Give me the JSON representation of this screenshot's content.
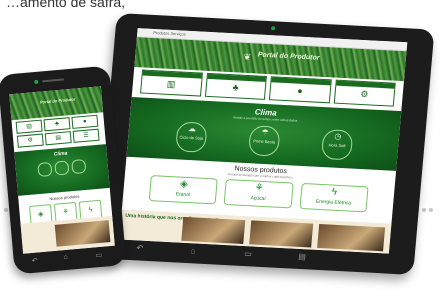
{
  "caption": "…amento de safra,",
  "tablet": {
    "topbar": "Produtos    Serviços",
    "logo_text": "Portal do Produtor",
    "logo_icon": "leaf-icon",
    "cards": [
      {
        "icon": "chart-icon"
      },
      {
        "icon": "plant-icon"
      },
      {
        "icon": "person-icon"
      },
      {
        "icon": "tractor-icon"
      }
    ],
    "clima": {
      "title": "Clima",
      "subtitle": "Acesse a previsão do tempo, entre outros dados",
      "circles": [
        "Ciclo de Soja",
        "Prime Besta",
        "Hora Soft"
      ]
    },
    "produtos": {
      "title": "Nossos produtos",
      "subtitle": "A maior tecnologia com o melhor custo-benefício",
      "items": [
        "Etanol",
        "Açúcar",
        "Energia Elétrica"
      ]
    },
    "bottom": {
      "title": "Uma história que nos orgulha e se traduz"
    },
    "nav": {
      "back": "↶",
      "home": "⌂",
      "recent": "▭",
      "menu": "▤"
    },
    "accent": "#1b6b1f"
  },
  "phone": {
    "logo_text": "Portal do Produtor",
    "clima_title": "Clima",
    "produtos_title": "Nossos produtos",
    "nav": {
      "back": "↶",
      "home": "⌂",
      "recent": "▭"
    }
  }
}
